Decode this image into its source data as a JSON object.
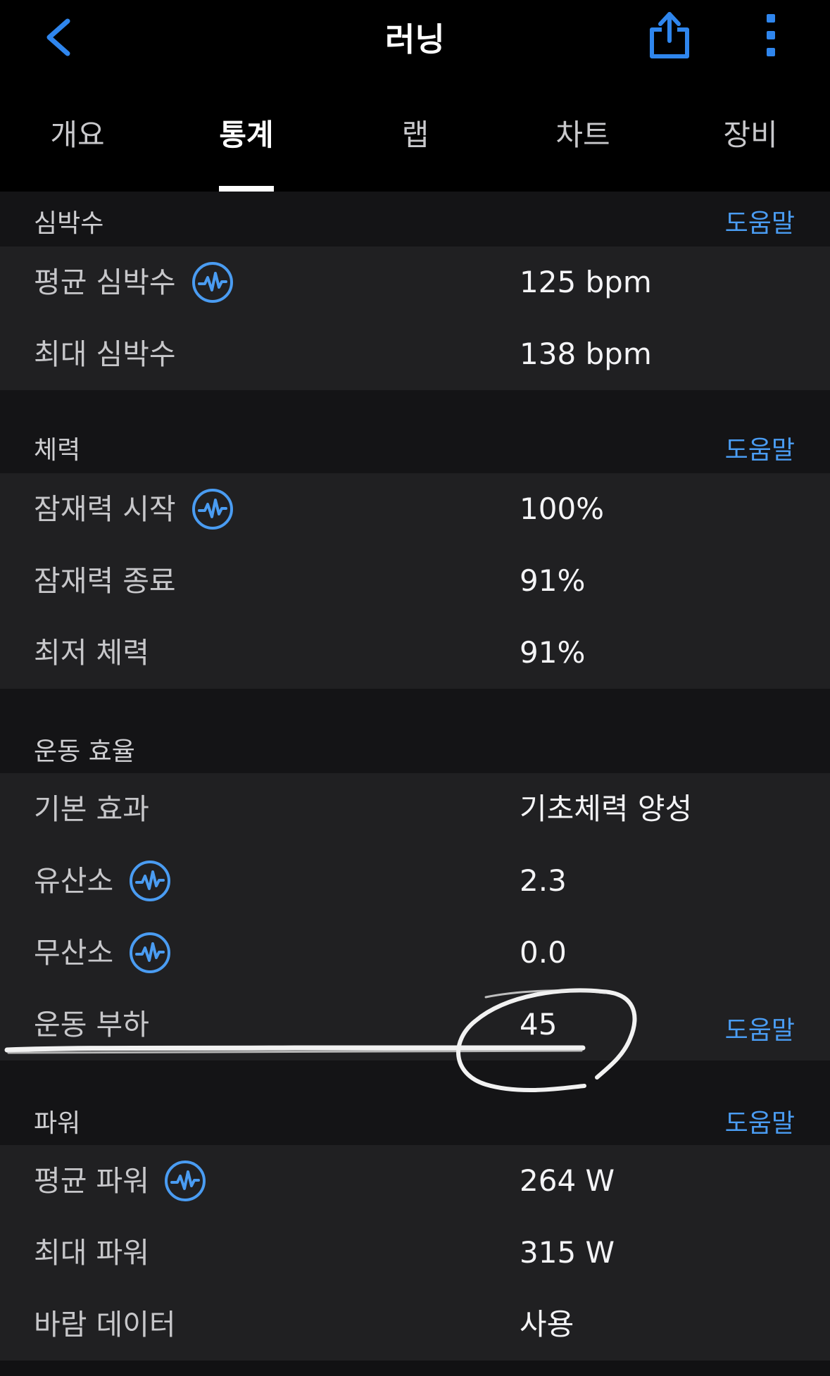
{
  "header": {
    "title": "러닝",
    "back_icon": "chevron-left-icon",
    "share_icon": "share-icon",
    "more_icon": "more-vertical-icon"
  },
  "tabs": [
    {
      "label": "개요",
      "active": false
    },
    {
      "label": "통계",
      "active": true
    },
    {
      "label": "랩",
      "active": false
    },
    {
      "label": "차트",
      "active": false
    },
    {
      "label": "장비",
      "active": false
    }
  ],
  "sections": {
    "heart_rate": {
      "title": "심박수",
      "help": "도움말",
      "rows": [
        {
          "label": "평균 심박수",
          "value": "125 bpm"
        },
        {
          "label": "최대 심박수",
          "value": "138 bpm"
        }
      ]
    },
    "stamina": {
      "title": "체력",
      "help": "도움말",
      "rows": [
        {
          "label": "잠재력 시작",
          "value": "100%"
        },
        {
          "label": "잠재력 종료",
          "value": "91%"
        },
        {
          "label": "최저 체력",
          "value": "91%"
        }
      ]
    },
    "training_effect": {
      "title": "운동 효율",
      "rows": [
        {
          "label": "기본 효과",
          "value": "기초체력 양성"
        },
        {
          "label": "유산소",
          "value": "2.3"
        },
        {
          "label": "무산소",
          "value": "0.0"
        },
        {
          "label": "운동 부하",
          "value": "45",
          "help": "도움말"
        }
      ]
    },
    "power": {
      "title": "파워",
      "help": "도움말",
      "rows": [
        {
          "label": "평균 파워",
          "value": "264 W"
        },
        {
          "label": "최대 파워",
          "value": "315 W"
        },
        {
          "label": "바람 데이터",
          "value": "사용"
        }
      ]
    }
  },
  "colors": {
    "accent": "#4a9cf2",
    "background": "#000000",
    "panel": "#202022",
    "section_header": "#141416"
  }
}
